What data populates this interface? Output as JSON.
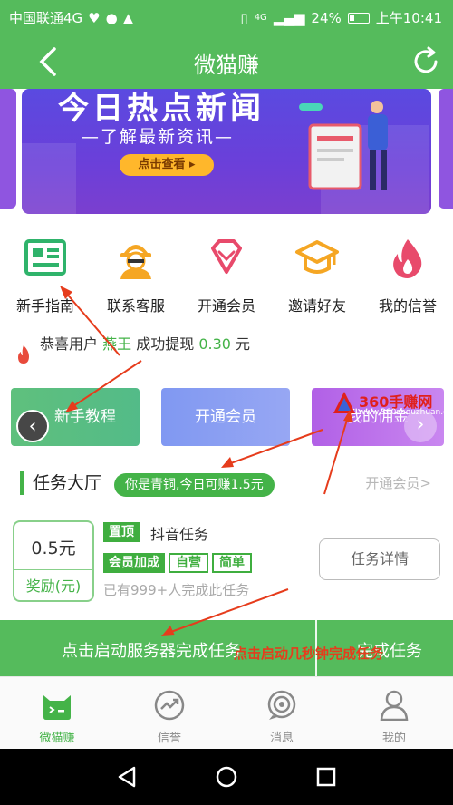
{
  "status_bar": {
    "carrier": "中国联通4G",
    "network": "4G",
    "battery": "24%",
    "time": "上午10:41"
  },
  "app_bar": {
    "title": "微猫赚",
    "back_icon": "chevron-left-icon",
    "refresh_icon": "refresh-icon"
  },
  "banner": {
    "headline": "今日热点新闻",
    "subtitle": "—了解最新资讯—",
    "cta": "点击查看 ▸"
  },
  "menu": [
    {
      "label": "新手指南",
      "icon": "guide-card-icon",
      "color": "#2fb36b"
    },
    {
      "label": "联系客服",
      "icon": "agent-icon",
      "color": "#f5a623"
    },
    {
      "label": "开通会员",
      "icon": "diamond-icon",
      "color": "#e84a6b"
    },
    {
      "label": "邀请好友",
      "icon": "graduation-cap-icon",
      "color": "#f5a623"
    },
    {
      "label": "我的信誉",
      "icon": "flame-icon",
      "color": "#e84a6b"
    }
  ],
  "notice": {
    "prefix": "恭喜用户",
    "user": "燕王",
    "action": "成功提现",
    "amount": "0.30",
    "unit": "元"
  },
  "cards": [
    {
      "label": "新手教程"
    },
    {
      "label": "开通会员"
    },
    {
      "label": "我的佣金"
    }
  ],
  "watermark": {
    "brand": "360手赚网",
    "url": "www.360shouzhuan.com"
  },
  "task_hall": {
    "title": "任务大厅",
    "level_pill": "你是青铜,今日可赚1.5元",
    "upgrade_link": "开通会员>"
  },
  "task": {
    "reward_amount": "0.5元",
    "reward_label": "奖励(元)",
    "pin_tag": "置顶",
    "name": "抖音任务",
    "tags": [
      "会员加成",
      "自营",
      "简单"
    ],
    "completed": "已有999+人完成此任务",
    "detail_button": "任务详情"
  },
  "actions": {
    "start": "点击启动服务器完成任务",
    "complete": "完成任务",
    "annotation": "点击启动几秒钟完成任务"
  },
  "tabs": [
    {
      "label": "微猫赚",
      "icon": "cat-face-icon",
      "active": true
    },
    {
      "label": "信誉",
      "icon": "trend-chart-icon",
      "active": false
    },
    {
      "label": "消息",
      "icon": "message-ring-icon",
      "active": false
    },
    {
      "label": "我的",
      "icon": "user-icon",
      "active": false
    }
  ],
  "colors": {
    "brand_green": "#55bb5c",
    "accent_green": "#44b348",
    "annotation_red": "#e63c1c"
  }
}
